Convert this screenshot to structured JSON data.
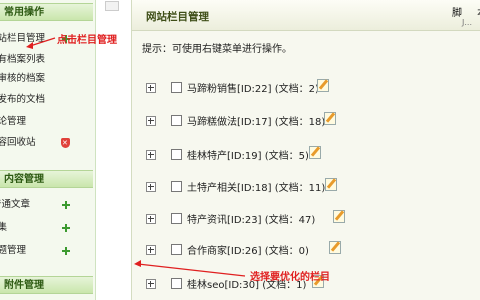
{
  "sidebar": {
    "sections": [
      {
        "title": "常用操作",
        "items": [
          {
            "label": "网站栏目管理",
            "icon": null
          },
          {
            "label": "所有档案列表",
            "icon": null
          },
          {
            "label": "待审核的档案",
            "icon": null
          },
          {
            "label": "我发布的文档",
            "icon": null
          },
          {
            "label": "评论管理",
            "icon": null
          },
          {
            "label": "内容回收站",
            "icon": "shield-icon"
          }
        ]
      },
      {
        "title": "内容管理",
        "items": [
          {
            "label": "普通文章",
            "icon": "add-icon"
          },
          {
            "label": "图集",
            "icon": "add-icon"
          },
          {
            "label": "专题管理",
            "icon": "add-icon"
          }
        ]
      },
      {
        "title": "附件管理",
        "items": []
      }
    ]
  },
  "header": {
    "title": "网站栏目管理",
    "script_label": "脚 本",
    "script_sub": "J..."
  },
  "tip": "提示：可使用右键菜单进行操作。",
  "categories": [
    {
      "label": "马蹄粉销售[ID:22] (文档：2)"
    },
    {
      "label": "马蹄糕做法[ID:17] (文档：18)"
    },
    {
      "label": "桂林特产[ID:19] (文档：5)"
    },
    {
      "label": "土特产相关[ID:18] (文档：11)"
    },
    {
      "label": "特产资讯[ID:23] (文档：47)"
    },
    {
      "label": "合作商家[ID:26] (文档：0)"
    },
    {
      "label": "桂林seo[ID:30] (文档：1)"
    }
  ],
  "annotations": {
    "click_column": "点击栏目管理",
    "choose_column": "选择要优化的栏目"
  },
  "colors": {
    "annotation": "#e02020",
    "sidebar_header": "#c9e6ac",
    "add_icon": "#3b9a2f"
  }
}
